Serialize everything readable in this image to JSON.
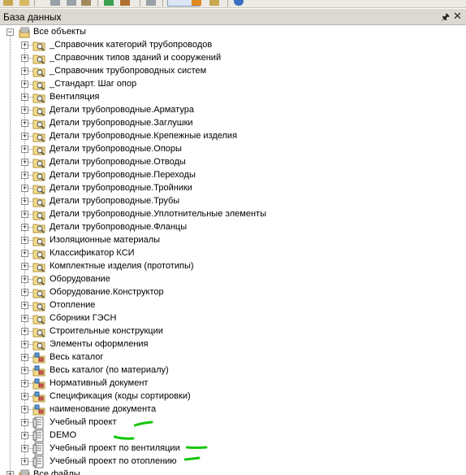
{
  "panel": {
    "title": "База данных",
    "pin_icon": "pin-icon",
    "close_icon": "close-icon"
  },
  "root": {
    "label": "Все объекты",
    "icon": "database-icon"
  },
  "items": [
    {
      "label": "_Справочник категорий трубопроводов",
      "icon": "folder-search-icon"
    },
    {
      "label": "_Справочник типов зданий и сооружений",
      "icon": "folder-search-icon"
    },
    {
      "label": "_Справочник трубопроводных систем",
      "icon": "folder-search-icon"
    },
    {
      "label": "_Стандарт. Шаг опор",
      "icon": "folder-search-icon"
    },
    {
      "label": "Вентиляция",
      "icon": "folder-search-icon"
    },
    {
      "label": "Детали трубопроводные.Арматура",
      "icon": "folder-search-icon"
    },
    {
      "label": "Детали трубопроводные.Заглушки",
      "icon": "folder-search-icon"
    },
    {
      "label": "Детали трубопроводные.Крепежные изделия",
      "icon": "folder-search-icon"
    },
    {
      "label": "Детали трубопроводные.Опоры",
      "icon": "folder-search-icon"
    },
    {
      "label": "Детали трубопроводные.Отводы",
      "icon": "folder-search-icon"
    },
    {
      "label": "Детали трубопроводные.Переходы",
      "icon": "folder-search-icon"
    },
    {
      "label": "Детали трубопроводные.Тройники",
      "icon": "folder-search-icon"
    },
    {
      "label": "Детали трубопроводные.Трубы",
      "icon": "folder-search-icon"
    },
    {
      "label": "Детали трубопроводные.Уплотнительные элементы",
      "icon": "folder-search-icon"
    },
    {
      "label": "Детали трубопроводные.Фланцы",
      "icon": "folder-search-icon"
    },
    {
      "label": "Изоляционные материалы",
      "icon": "folder-search-icon"
    },
    {
      "label": "Классификатор КСИ",
      "icon": "folder-search-icon"
    },
    {
      "label": "Комплектные изделия (прототипы)",
      "icon": "folder-search-icon"
    },
    {
      "label": "Оборудование",
      "icon": "folder-search-icon"
    },
    {
      "label": "Оборудование.Конструктор",
      "icon": "folder-search-icon"
    },
    {
      "label": "Отопление",
      "icon": "folder-search-icon"
    },
    {
      "label": "Сборники ГЭСН",
      "icon": "folder-search-icon"
    },
    {
      "label": "Строительные конструкции",
      "icon": "folder-search-icon"
    },
    {
      "label": "Элементы оформления",
      "icon": "folder-search-icon"
    },
    {
      "label": "Весь каталог",
      "icon": "catalog-icon"
    },
    {
      "label": "Весь каталог (по материалу)",
      "icon": "catalog-icon"
    },
    {
      "label": "Нормативный документ",
      "icon": "catalog-icon"
    },
    {
      "label": "Спецификация (коды сортировки)",
      "icon": "catalog-icon"
    },
    {
      "label": "наименование документа",
      "icon": "catalog-icon"
    },
    {
      "label": "Учебный проект",
      "icon": "project-icon"
    },
    {
      "label": "DEMO",
      "icon": "project-icon"
    },
    {
      "label": "Учебный проект по вентиляции",
      "icon": "project-icon"
    },
    {
      "label": "Учебный проект по отоплению",
      "icon": "project-icon"
    }
  ],
  "next_root": {
    "label": "Все файлы"
  },
  "annotation_color": "#16c60c"
}
